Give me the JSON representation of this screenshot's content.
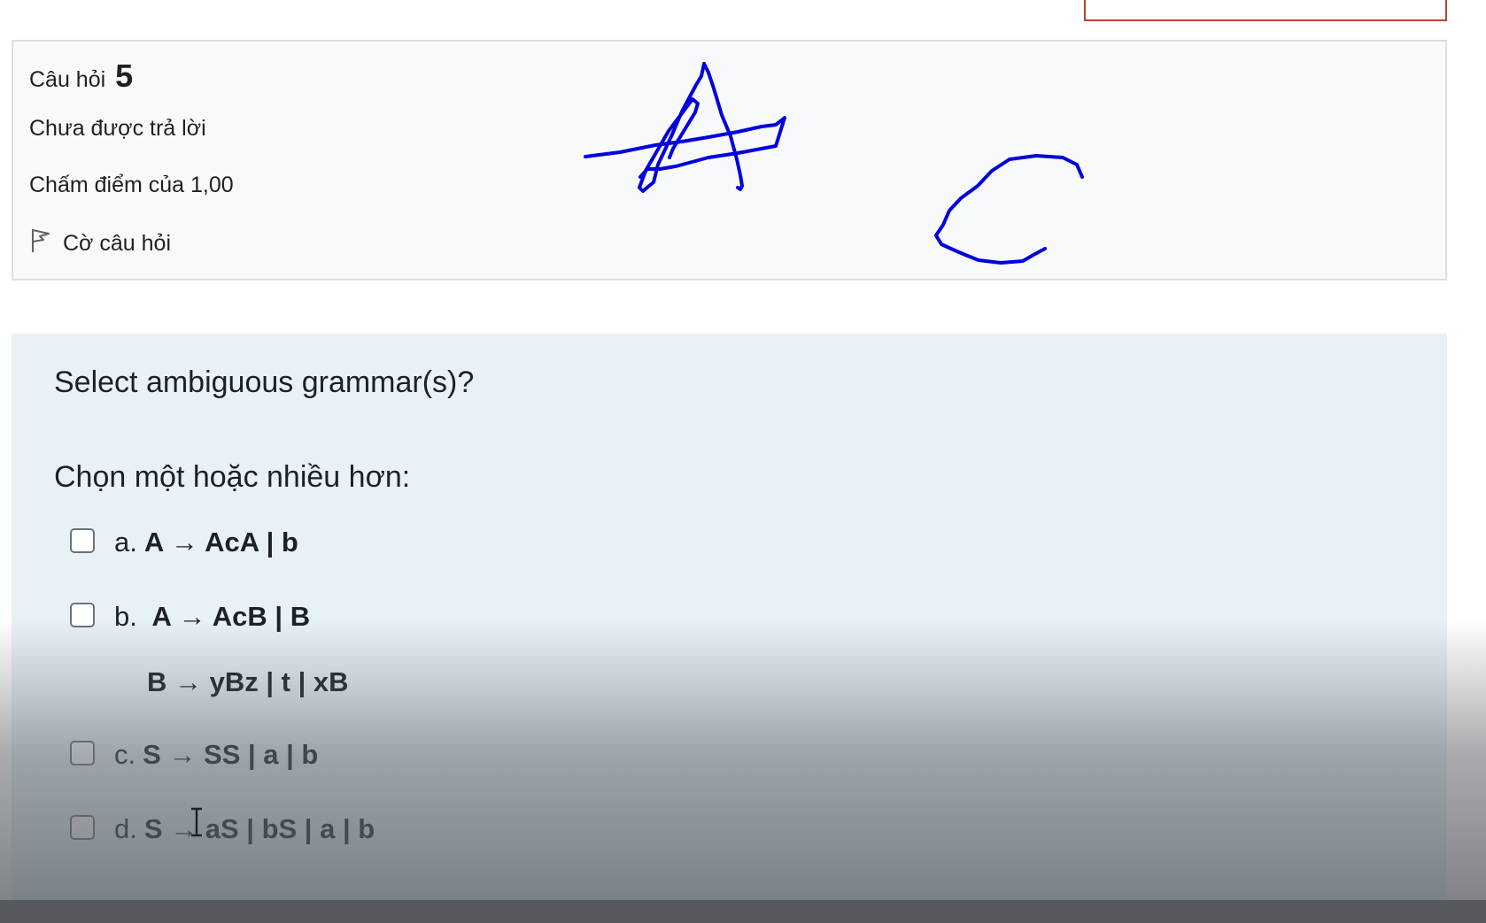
{
  "question_info": {
    "label": "Câu hỏi",
    "number": "5",
    "state": "Chưa được trả lời",
    "grade": "Chấm điểm của 1,00",
    "flag_label": "Cờ câu hỏi"
  },
  "question": {
    "prompt": "Select ambiguous grammar(s)?",
    "instruction": "Chọn một hoặc nhiều hơn:",
    "options": [
      {
        "letter": "a.",
        "rule": "A → AcA | b",
        "checked": true
      },
      {
        "letter": "b.",
        "rule": "A → AcB | B",
        "rule_line2": "B → yBz | t | xB",
        "checked": false
      },
      {
        "letter": "c.",
        "rule": "S → SS | a | b",
        "checked": true
      },
      {
        "letter": "d.",
        "rule": "S → aS | bS | a | b",
        "checked": false
      }
    ]
  },
  "colors": {
    "accent": "#0f6cbf",
    "ink": "#0000dd",
    "content_bg": "#e7f2f7",
    "info_bg": "#f8f9fa"
  }
}
